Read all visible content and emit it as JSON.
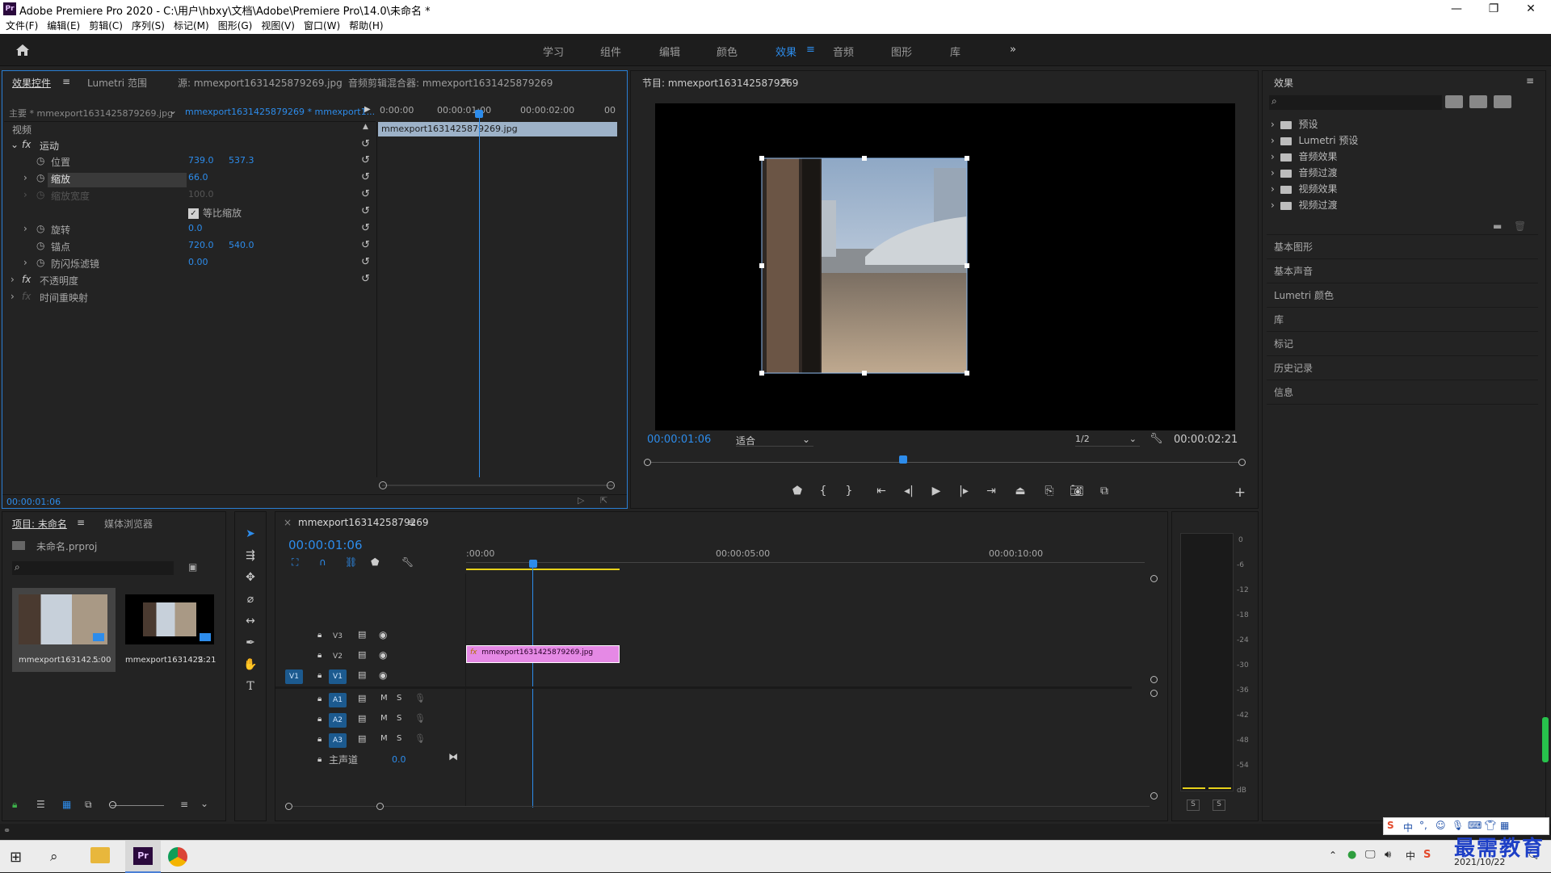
{
  "window": {
    "title": "Adobe Premiere Pro 2020 - C:\\用户\\hbxy\\文档\\Adobe\\Premiere Pro\\14.0\\未命名 *",
    "app_icon": "Pr"
  },
  "menu": [
    "文件(F)",
    "编辑(E)",
    "剪辑(C)",
    "序列(S)",
    "标记(M)",
    "图形(G)",
    "视图(V)",
    "窗口(W)",
    "帮助(H)"
  ],
  "workspaces": [
    {
      "label": "学习",
      "active": false
    },
    {
      "label": "组件",
      "active": false
    },
    {
      "label": "编辑",
      "active": false
    },
    {
      "label": "颜色",
      "active": false
    },
    {
      "label": "效果",
      "active": true
    },
    {
      "label": "音频",
      "active": false
    },
    {
      "label": "图形",
      "active": false
    },
    {
      "label": "库",
      "active": false
    }
  ],
  "workspace_more": "»",
  "effect_controls": {
    "tabs": [
      "效果控件",
      "Lumetri 范围",
      "源: mmexport1631425879269.jpg",
      "音频剪辑混合器: mmexport1631425879269"
    ],
    "master_label": "主要 * mmexport1631425879269.jpg",
    "sequence_label": "mmexport1631425879269 * mmexport1...",
    "ruler": [
      "0:00:00",
      "00:00:01:00",
      "00:00:02:00",
      "00"
    ],
    "clip_label": "mmexport1631425879269.jpg",
    "section_video": "视频",
    "motion": "运动",
    "position_label": "位置",
    "position_x": "739.0",
    "position_y": "537.3",
    "scale_label": "缩放",
    "scale_value": "66.0",
    "scale_width_label": "缩放宽度",
    "scale_width_value": "100.0",
    "uniform_label": "等比缩放",
    "rotation_label": "旋转",
    "rotation_value": "0.0",
    "anchor_label": "锚点",
    "anchor_x": "720.0",
    "anchor_y": "540.0",
    "flicker_label": "防闪烁滤镜",
    "flicker_value": "0.00",
    "opacity_label": "不透明度",
    "time_remap_label": "时间重映射",
    "current_time": "00:00:01:06"
  },
  "program_monitor": {
    "title": "节目: mmexport1631425879269",
    "timecode": "00:00:01:06",
    "fit": "适合",
    "resolution": "1/2",
    "duration": "00:00:02:21"
  },
  "effects_panel": {
    "title": "效果",
    "items": [
      "预设",
      "Lumetri 预设",
      "音频效果",
      "音频过渡",
      "视频效果",
      "视频过渡"
    ],
    "sections": [
      "基本图形",
      "基本声音",
      "Lumetri 颜色",
      "库",
      "标记",
      "历史记录",
      "信息"
    ]
  },
  "project_panel": {
    "tabs": [
      "项目: 未命名",
      "媒体浏览器"
    ],
    "project_file": "未命名.prproj",
    "items": [
      {
        "name": "mmexport163142...",
        "duration": "5:00"
      },
      {
        "name": "mmexport163142S...",
        "duration": "2:21"
      }
    ]
  },
  "timeline": {
    "tab": "mmexport1631425879269",
    "timecode": "00:00:01:06",
    "ruler": [
      ":00:00",
      "00:00:05:00",
      "00:00:10:00"
    ],
    "video_tracks": [
      "V3",
      "V2",
      "V1"
    ],
    "source_patch": "V1",
    "audio_tracks": [
      "A1",
      "A2",
      "A3"
    ],
    "master_label": "主声道",
    "master_value": "0.0",
    "clip_label": "mmexport1631425879269.jpg",
    "m_label": "M",
    "s_label": "S"
  },
  "audio_meter": {
    "scale": [
      "0",
      "-6",
      "-12",
      "-18",
      "-24",
      "-30",
      "-36",
      "-42",
      "-48",
      "-54",
      "dB"
    ],
    "solo": [
      "S",
      "S"
    ]
  },
  "taskbar": {
    "date": "2021/10/22",
    "time": "",
    "ime": "中",
    "watermark": "最需教育"
  },
  "colors": {
    "accent": "#2d8ceb",
    "clip_pink": "#e589e5",
    "panel_bg": "#232323",
    "header_bg": "#1d1d1d"
  }
}
